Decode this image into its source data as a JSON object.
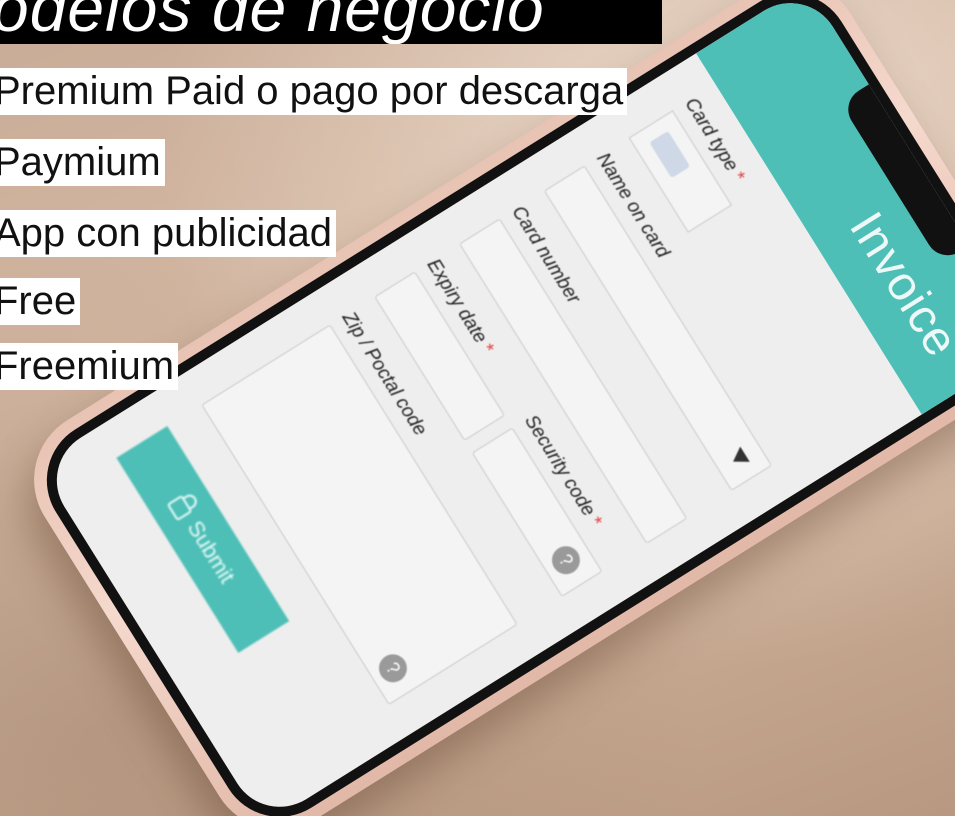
{
  "overlay": {
    "title": "odelos de negocio",
    "items": [
      {
        "label": "Premium Paid o pago por descarga"
      },
      {
        "label": "Paymium"
      },
      {
        "label": "App con publicidad"
      },
      {
        "label": "Free"
      },
      {
        "label": "Freemium"
      }
    ]
  },
  "phone_app": {
    "header_title": "Invoice",
    "card_type_label": "Card type",
    "required_mark": "*",
    "name_on_card_label": "Name on card",
    "card_number_label": "Card number",
    "expiry_date_label": "Expiry date",
    "security_code_label": "Security code",
    "zip_label": "Zip / Poctal code",
    "help_glyph": "?",
    "submit_label": "Submit"
  },
  "colors": {
    "accent": "#4dbfb7",
    "title_bg": "#000000",
    "title_fg": "#ffffff",
    "item_bg": "#ffffff",
    "required": "#e14141",
    "phone_case": "#f0cfc2"
  }
}
